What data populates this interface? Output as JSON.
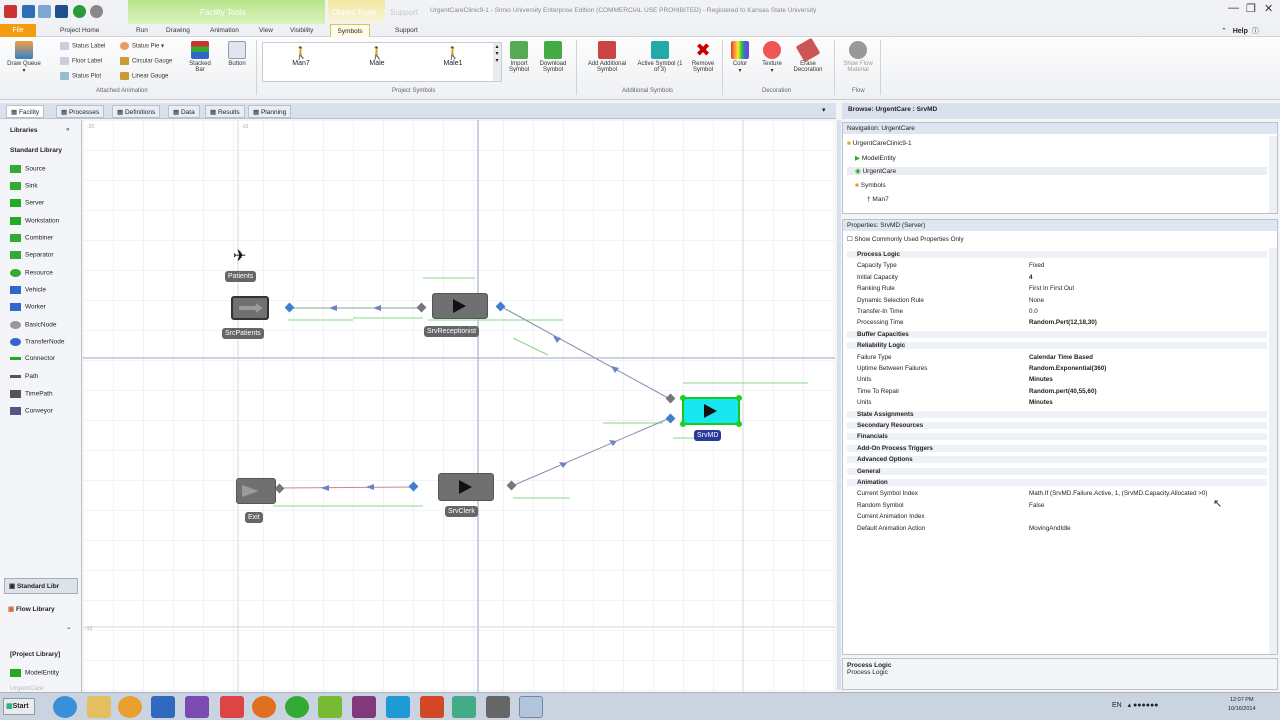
{
  "app": {
    "window_title": "UrgentCareClinic9-1 - Simio University Enterprise Edition (COMMERCIAL USE PROHIBITED) - Registered to Kansas State University",
    "context_tab_title": "Facility Tools",
    "context_subtab": "Object Tools",
    "support_tab": "Support"
  },
  "ribbon_tabs": [
    "File",
    "Project Home",
    "Run",
    "Drawing",
    "Animation",
    "View",
    "Visibility",
    "Symbols",
    "Support"
  ],
  "help_label": "Help",
  "ribbon": {
    "draw_queue": "Draw Queue",
    "attached": [
      {
        "label": "Status Label",
        "icon": "status-label-icon"
      },
      {
        "label": "Floor Label",
        "icon": "floor-label-icon"
      },
      {
        "label": "Status Plot",
        "icon": "status-plot-icon"
      },
      {
        "label": "Status Pie",
        "icon": "status-pie-icon"
      },
      {
        "label": "Circular Gauge",
        "icon": "circular-gauge-icon"
      },
      {
        "label": "Linear Gauge",
        "icon": "linear-gauge-icon"
      }
    ],
    "stacked_bar": "Stacked Bar",
    "button": "Button",
    "group_attached": "Attached Animation",
    "project_symbols": [
      "Man7",
      "Male",
      "Male1"
    ],
    "group_project_symbols": "Project Symbols",
    "import_symbol": "Import Symbol",
    "download_symbol": "Download Symbol",
    "add_additional": "Add Additional Symbol",
    "active_symbol": "Active Symbol (1 of 3)",
    "remove_symbol": "Remove Symbol",
    "group_additional": "Additional Symbols",
    "color": "Color",
    "texture": "Texture",
    "erase": "Erase Decoration",
    "group_decoration": "Decoration",
    "show_flow": "Show Flow Material",
    "group_flow": "Flow"
  },
  "workspace_tabs": [
    "Facility",
    "Processes",
    "Definitions",
    "Data",
    "Results",
    "Planning"
  ],
  "libraries": {
    "header": "Libraries",
    "standard": "Standard Library",
    "items": [
      "Source",
      "Sink",
      "Server",
      "Workstation",
      "Combiner",
      "Separator",
      "Resource",
      "Vehicle",
      "Worker",
      "BasicNode",
      "TransferNode",
      "Connector",
      "Path",
      "TimePath",
      "Conveyor"
    ],
    "standard_tab": "Standard Libr",
    "flow_tab": "Flow Library",
    "project_library": "[Project Library]",
    "project_items": [
      "ModelEntity",
      "UrgentCare"
    ]
  },
  "canvas": {
    "patients": "Patients",
    "src_patients": "SrcPatients",
    "srv_receptionist": "SrvReceptionist",
    "srv_md": "SrvMD",
    "exit": "Exit",
    "srv_clerk": "SrvClerk"
  },
  "browse_header": "Browse: UrgentCare : SrvMD",
  "navigation": {
    "header": "Navigation: UrgentCare",
    "items": [
      "UrgentCareClinic9-1",
      "ModelEntity",
      "UrgentCare",
      "Symbols",
      "Man7"
    ]
  },
  "properties": {
    "header": "Properties: SrvMD (Server)",
    "show_common": "Show Commonly Used Properties Only",
    "rows": [
      {
        "name": "Process Logic",
        "value": "",
        "group": true
      },
      {
        "name": "Capacity Type",
        "value": "Fixed"
      },
      {
        "name": "Initial Capacity",
        "value": "4"
      },
      {
        "name": "Ranking Rule",
        "value": "First In First Out"
      },
      {
        "name": "Dynamic Selection Rule",
        "value": "None"
      },
      {
        "name": "Transfer-In Time",
        "value": "0.0"
      },
      {
        "name": "Processing Time",
        "value": "Random.Pert(12,18,30)"
      },
      {
        "name": "Buffer Capacities",
        "value": "",
        "group": true
      },
      {
        "name": "Reliability Logic",
        "value": "",
        "group": true
      },
      {
        "name": "Failure Type",
        "value": "Calendar Time Based"
      },
      {
        "name": "Uptime Between Failures",
        "value": "Random.Exponential(360)"
      },
      {
        "name": "Units",
        "value": "Minutes"
      },
      {
        "name": "Time To Repair",
        "value": "Random.pert(40,55,60)"
      },
      {
        "name": "Units",
        "value": "Minutes"
      },
      {
        "name": "State Assignments",
        "value": "",
        "group": true
      },
      {
        "name": "Secondary Resources",
        "value": "",
        "group": true
      },
      {
        "name": "Financials",
        "value": "",
        "group": true
      },
      {
        "name": "Add-On Process Triggers",
        "value": "",
        "group": true
      },
      {
        "name": "Advanced Options",
        "value": "",
        "group": true
      },
      {
        "name": "General",
        "value": "",
        "group": true
      },
      {
        "name": "Animation",
        "value": "",
        "group": true
      },
      {
        "name": "Current Symbol Index",
        "value": "Math.If (SrvMD.Failure.Active, 1, (SrvMD.Capacity.Allocated >0)"
      },
      {
        "name": "Random Symbol",
        "value": "False"
      },
      {
        "name": "Current Animation Index",
        "value": ""
      },
      {
        "name": "Default Animation Action",
        "value": "MovingAndIdle"
      }
    ]
  },
  "help_pane": {
    "title": "Process Logic",
    "body": "Process Logic"
  },
  "taskbar": {
    "start": "Start",
    "lang": "EN",
    "time": "12:07 PM",
    "date": "10/16/2014"
  }
}
